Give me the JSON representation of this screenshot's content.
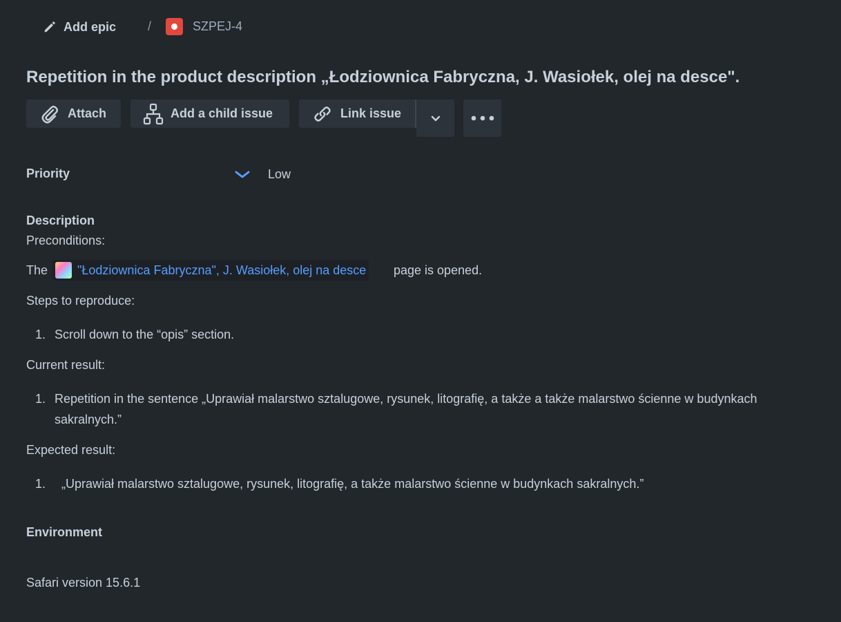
{
  "breadcrumb": {
    "add_epic_label": "Add epic",
    "separator": "/",
    "issue_key": "SZPEJ-4",
    "issue_type_color": "#e2483d"
  },
  "issue": {
    "title": "Repetition in the product description „Łodziownica Fabryczna, J. Wasiołek, olej na desce\"."
  },
  "toolbar": {
    "attach_label": "Attach",
    "add_child_label": "Add a child issue",
    "link_issue_label": "Link issue",
    "attach_icon": "paperclip-icon",
    "child_icon": "hierarchy-icon",
    "link_icon": "link-icon",
    "dropdown_icon": "chevron-down-icon",
    "more_icon": "more-icon"
  },
  "fields": {
    "priority_label": "Priority",
    "priority_value": "Low",
    "priority_color": "#579dff",
    "environment_label": "Environment",
    "environment_value": "Safari version 15.6.1"
  },
  "description": {
    "label": "Description",
    "preconditions_heading": "Preconditions:",
    "precondition_prefix": "The",
    "precondition_link_text": "\"Łodziownica Fabryczna\", J. Wasiołek, olej na desce",
    "precondition_suffix": "page  is opened.",
    "steps_heading": "Steps to reproduce:",
    "steps": [
      {
        "number": "1.",
        "text": "Scroll down to the “opis” section."
      }
    ],
    "current_heading": "Current result:",
    "current": [
      {
        "number": "1.",
        "text_line1": "Repetition in the sentence „Uprawiał malarstwo sztalugowe, rysunek, litografię, a także a także malarstwo ścienne w budynkach",
        "text_line2": "sakralnych.”"
      }
    ],
    "expected_heading": "Expected result:",
    "expected": [
      {
        "number": "1.",
        "text": "„Uprawiał malarstwo sztalugowe, rysunek, litografię, a także malarstwo ścienne w budynkach sakralnych.”"
      }
    ]
  },
  "colors": {
    "background": "#22272b",
    "text": "#c7d1db",
    "link": "#579dff",
    "button_bg": "#2c333a"
  }
}
